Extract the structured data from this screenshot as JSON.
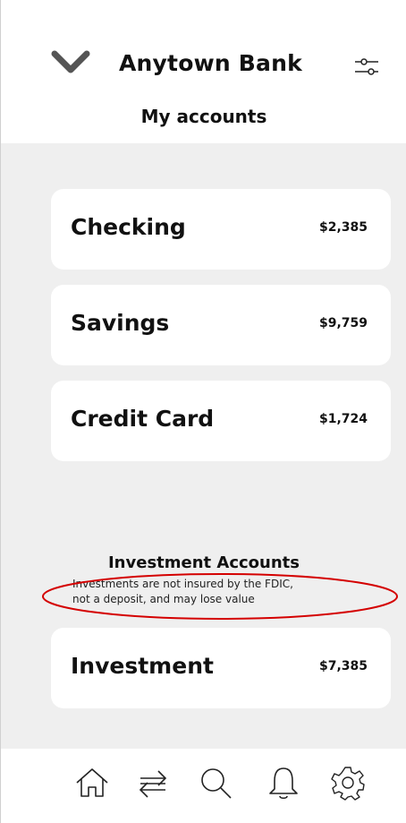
{
  "header": {
    "bank_name": "Anytown Bank",
    "subtitle": "My accounts",
    "collapse_icon": "chevron-down-icon",
    "filter_icon": "sliders-icon"
  },
  "accounts": [
    {
      "name": "Checking",
      "amount": "$2,385"
    },
    {
      "name": "Savings",
      "amount": "$9,759"
    },
    {
      "name": "Credit Card",
      "amount": "$1,724"
    }
  ],
  "investments": {
    "title": "Investment Accounts",
    "disclaimer_line1": "Investments are not insured by the FDIC,",
    "disclaimer_line2": "not a deposit, and may lose value",
    "highlight_color": "#d40000",
    "accounts": [
      {
        "name": "Investment",
        "amount": "$7,385"
      }
    ]
  },
  "nav": {
    "items": [
      {
        "icon": "home-icon"
      },
      {
        "icon": "transfer-icon"
      },
      {
        "icon": "search-icon"
      },
      {
        "icon": "bell-icon"
      },
      {
        "icon": "gear-icon"
      }
    ]
  }
}
